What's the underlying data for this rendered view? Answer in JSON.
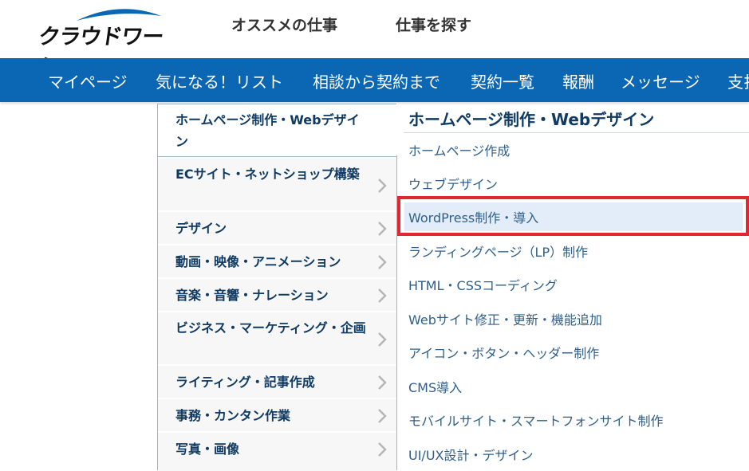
{
  "header": {
    "logo_text": "クラウドワークス",
    "links": [
      "オススメの仕事",
      "仕事を探す"
    ]
  },
  "nav": {
    "items": [
      "マイページ",
      "気になる！リスト",
      "相談から契約まで",
      "契約一覧",
      "報酬",
      "メッセージ",
      "支払"
    ]
  },
  "categories": [
    {
      "label": "ホームページ制作・Webデザイン",
      "active": true
    },
    {
      "label": "ECサイト・ネットショップ構築"
    },
    {
      "label": "デザイン"
    },
    {
      "label": "動画・映像・アニメーション"
    },
    {
      "label": "音楽・音響・ナレーション"
    },
    {
      "label": "ビジネス・マーケティング・企画"
    },
    {
      "label": "ライティング・記事作成"
    },
    {
      "label": "事務・カンタン作業"
    },
    {
      "label": "写真・画像"
    }
  ],
  "panel": {
    "title": "ホームページ制作・Webデザイン",
    "items": [
      "ホームページ作成",
      "ウェブデザイン",
      "WordPress制作・導入",
      "ランディングページ（LP）制作",
      "HTML・CSSコーディング",
      "Webサイト修正・更新・機能追加",
      "アイコン・ボタン・ヘッダー制作",
      "CMS導入",
      "モバイルサイト・スマートフォンサイト制作",
      "UI/UX設計・デザイン"
    ]
  },
  "colors": {
    "nav_bg": "#0b67b3",
    "highlight_border": "#e3262f",
    "highlight_fill": "#e3edf9",
    "category_text": "#0f3a63",
    "link_text": "#2f5f8a"
  }
}
